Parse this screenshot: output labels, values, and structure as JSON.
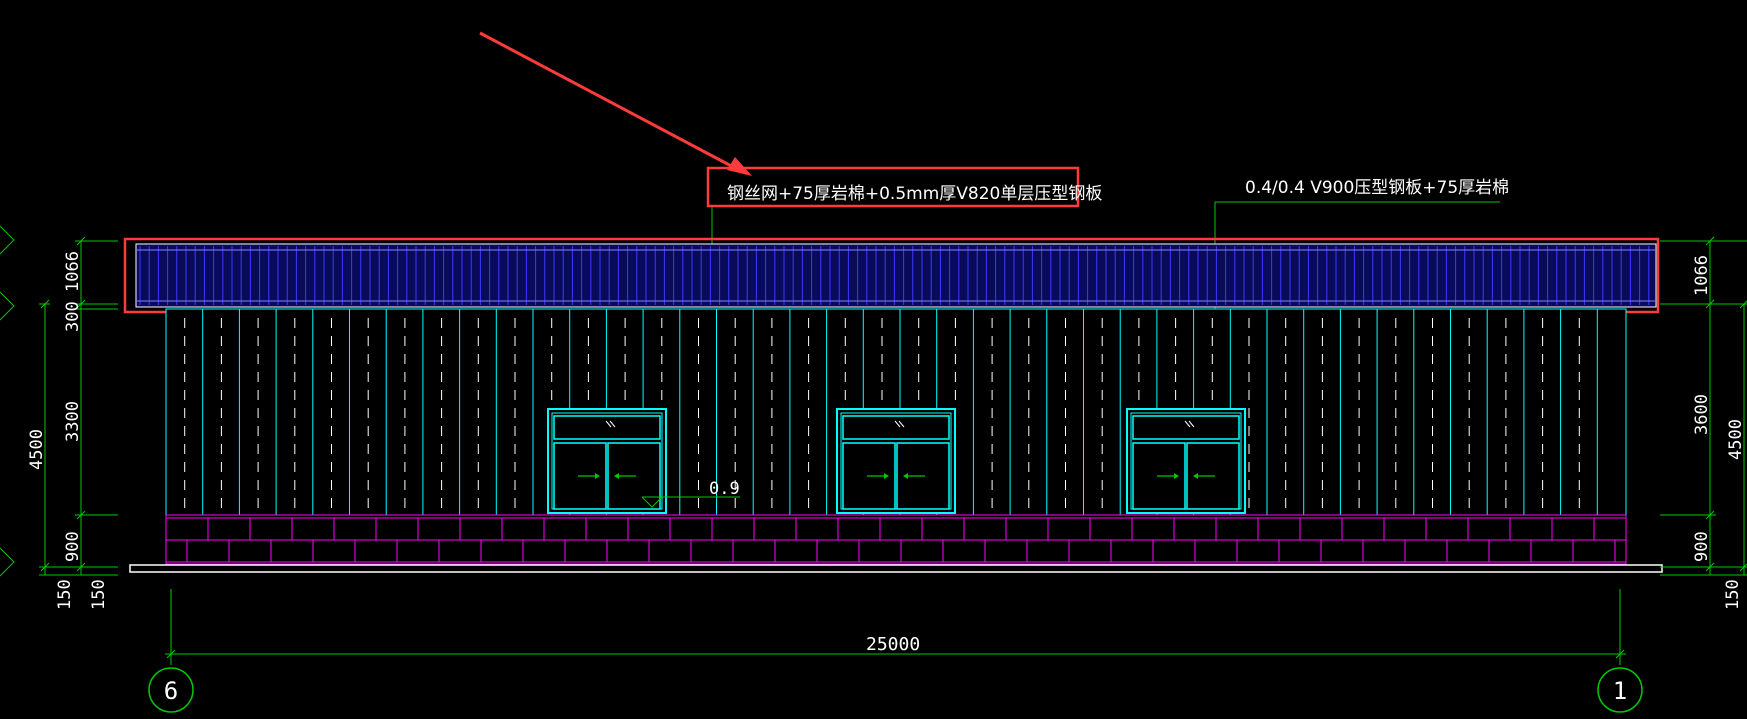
{
  "annotations": {
    "roof_note": "钢丝网+75厚岩棉+0.5mm厚V820单层压型钢板",
    "wall_note": "0.4/0.4 V900压型钢板+75厚岩棉",
    "threshold_note": "0.9"
  },
  "dimensions": {
    "left_1066": "1066",
    "left_300": "300",
    "left_3300": "3300",
    "left_900": "900",
    "left_4500": "4500",
    "left_150a": "150",
    "left_150b": "150",
    "right_1066": "1066",
    "right_3600": "3600",
    "right_900": "900",
    "right_4500": "4500",
    "right_150": "150",
    "overall_width": "25000"
  },
  "axes": {
    "left": "6",
    "right": "1"
  },
  "colors": {
    "background": "#000000",
    "dimension": "#00c800",
    "wall_panel": "#00ffff",
    "brick": "#ff00ff",
    "roof_fill": "#0a0a5a",
    "highlight": "#ff3b3b",
    "text": "#ffffff"
  }
}
